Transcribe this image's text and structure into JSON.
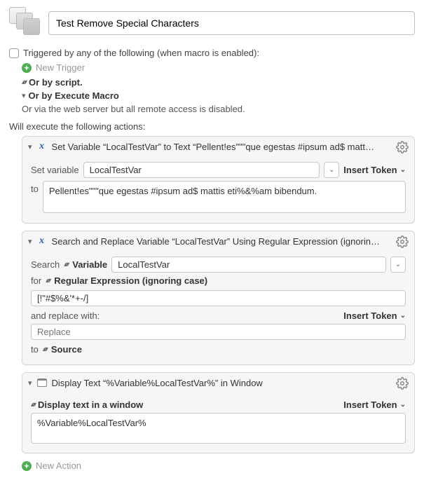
{
  "header": {
    "title_value": "Test Remove Special Characters"
  },
  "triggers": {
    "label": "Triggered by any of the following (when macro is enabled):",
    "new_trigger": "New Trigger",
    "or_by_script": "Or by script.",
    "or_by_execute_macro": "Or by Execute Macro",
    "web_server_note": "Or via the web server but all remote access is disabled."
  },
  "execute_label": "Will execute the following actions:",
  "actions": [
    {
      "title": "Set Variable “LocalTestVar” to Text “Pellent!es\"\"\"que egestas #ipsum ad$ matt…",
      "set_variable_label": "Set variable",
      "variable_name": "LocalTestVar",
      "insert_token": "Insert Token",
      "to_label": "to",
      "text_value": "Pellent!es\"\"\"que egestas #ipsum ad$ mattis eti%&%am bibendum."
    },
    {
      "title": "Search and Replace Variable “LocalTestVar” Using Regular Expression (ignorin…",
      "search_label": "Search",
      "variable_menu": "Variable",
      "variable_value": "LocalTestVar",
      "for_label": "for",
      "for_mode": "Regular Expression (ignoring case)",
      "pattern": "[!\"#$%&'*+-/]",
      "and_replace_label": "and replace with:",
      "insert_token": "Insert Token",
      "replace_placeholder": "Replace",
      "to_label": "to",
      "to_mode": "Source"
    },
    {
      "title": "Display Text “%Variable%LocalTestVar%” in Window",
      "display_mode": "Display text in a window",
      "insert_token": "Insert Token",
      "text_value": "%Variable%LocalTestVar%"
    }
  ],
  "new_action": "New Action"
}
